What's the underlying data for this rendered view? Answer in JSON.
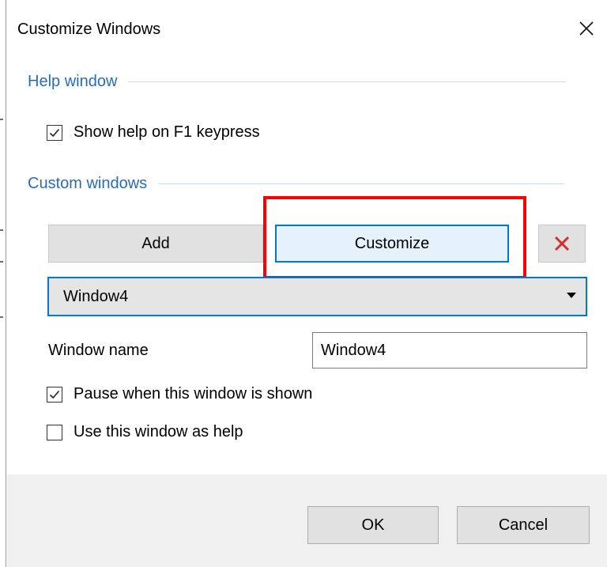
{
  "window": {
    "title": "Customize Windows"
  },
  "help_section": {
    "header": "Help window",
    "show_help_checkbox": {
      "label": "Show help on F1 keypress",
      "checked": true
    }
  },
  "custom_section": {
    "header": "Custom windows",
    "add_label": "Add",
    "customize_label": "Customize",
    "delete_icon": "red-x-icon",
    "selected_window": "Window4",
    "window_name_label": "Window name",
    "window_name_value": "Window4",
    "pause_checkbox": {
      "label": "Pause when this window is shown",
      "checked": true
    },
    "use_as_help_checkbox": {
      "label": "Use this window as help",
      "checked": false
    }
  },
  "footer": {
    "ok_label": "OK",
    "cancel_label": "Cancel"
  },
  "colors": {
    "accent": "#0078d7",
    "section_header": "#2a6db5",
    "highlight": "#ff0000",
    "delete_icon": "#d0312d"
  }
}
